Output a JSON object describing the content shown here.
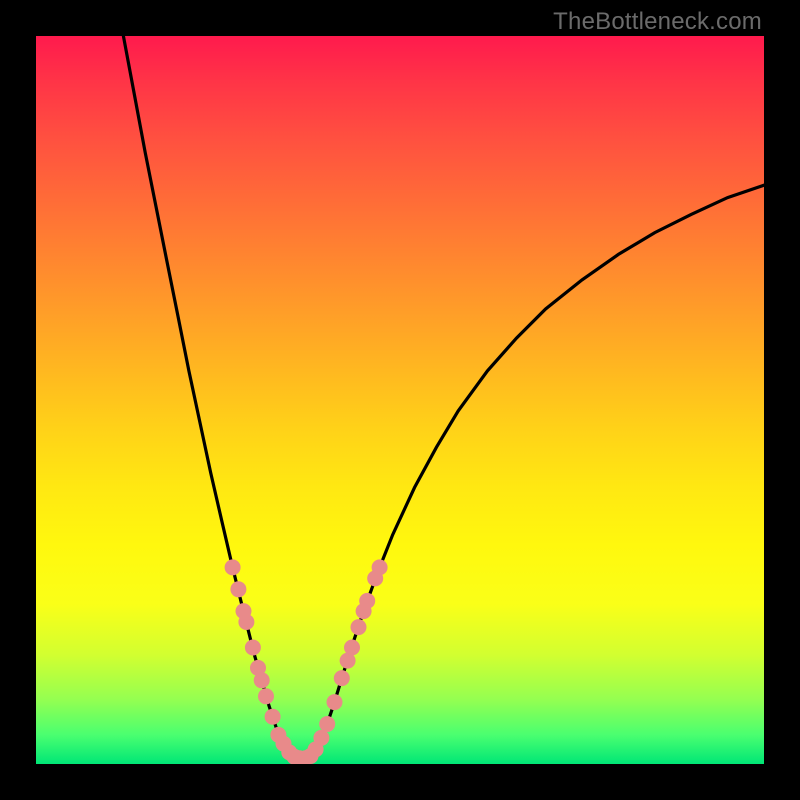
{
  "watermark": "TheBottleneck.com",
  "colors": {
    "gradient_top": "#ff1a4d",
    "gradient_bottom": "#00e676",
    "curve_stroke": "#000000",
    "marker_fill": "#e88a8a",
    "marker_stroke": "#b85a5a",
    "frame": "#000000"
  },
  "chart_data": {
    "type": "line",
    "title": "",
    "xlabel": "",
    "ylabel": "",
    "xlim": [
      0,
      100
    ],
    "ylim": [
      0,
      100
    ],
    "curve_points": [
      {
        "x": 12.0,
        "y": 100.0
      },
      {
        "x": 13.5,
        "y": 92.0
      },
      {
        "x": 15.0,
        "y": 84.0
      },
      {
        "x": 16.5,
        "y": 76.5
      },
      {
        "x": 18.0,
        "y": 69.0
      },
      {
        "x": 19.5,
        "y": 61.5
      },
      {
        "x": 21.0,
        "y": 54.0
      },
      {
        "x": 22.5,
        "y": 47.0
      },
      {
        "x": 24.0,
        "y": 40.0
      },
      {
        "x": 25.5,
        "y": 33.5
      },
      {
        "x": 27.0,
        "y": 27.0
      },
      {
        "x": 28.0,
        "y": 23.0
      },
      {
        "x": 29.0,
        "y": 19.0
      },
      {
        "x": 30.0,
        "y": 15.0
      },
      {
        "x": 31.0,
        "y": 11.5
      },
      {
        "x": 32.0,
        "y": 8.0
      },
      {
        "x": 33.0,
        "y": 5.0
      },
      {
        "x": 34.0,
        "y": 2.8
      },
      {
        "x": 35.0,
        "y": 1.4
      },
      {
        "x": 36.0,
        "y": 0.8
      },
      {
        "x": 37.0,
        "y": 0.8
      },
      {
        "x": 38.0,
        "y": 1.4
      },
      {
        "x": 39.0,
        "y": 3.0
      },
      {
        "x": 40.0,
        "y": 5.5
      },
      {
        "x": 41.0,
        "y": 8.5
      },
      {
        "x": 42.0,
        "y": 11.8
      },
      {
        "x": 43.5,
        "y": 16.5
      },
      {
        "x": 45.0,
        "y": 21.0
      },
      {
        "x": 47.0,
        "y": 26.5
      },
      {
        "x": 49.0,
        "y": 31.5
      },
      {
        "x": 52.0,
        "y": 38.0
      },
      {
        "x": 55.0,
        "y": 43.5
      },
      {
        "x": 58.0,
        "y": 48.5
      },
      {
        "x": 62.0,
        "y": 54.0
      },
      {
        "x": 66.0,
        "y": 58.5
      },
      {
        "x": 70.0,
        "y": 62.5
      },
      {
        "x": 75.0,
        "y": 66.5
      },
      {
        "x": 80.0,
        "y": 70.0
      },
      {
        "x": 85.0,
        "y": 73.0
      },
      {
        "x": 90.0,
        "y": 75.5
      },
      {
        "x": 95.0,
        "y": 77.8
      },
      {
        "x": 100.0,
        "y": 79.5
      }
    ],
    "marker_points": [
      {
        "x": 27.0,
        "y": 27.0
      },
      {
        "x": 27.8,
        "y": 24.0
      },
      {
        "x": 28.5,
        "y": 21.0
      },
      {
        "x": 28.9,
        "y": 19.5
      },
      {
        "x": 29.8,
        "y": 16.0
      },
      {
        "x": 30.5,
        "y": 13.2
      },
      {
        "x": 31.0,
        "y": 11.5
      },
      {
        "x": 31.6,
        "y": 9.3
      },
      {
        "x": 32.5,
        "y": 6.5
      },
      {
        "x": 33.3,
        "y": 4.0
      },
      {
        "x": 34.0,
        "y": 2.8
      },
      {
        "x": 34.8,
        "y": 1.6
      },
      {
        "x": 35.5,
        "y": 1.0
      },
      {
        "x": 36.2,
        "y": 0.8
      },
      {
        "x": 37.0,
        "y": 0.8
      },
      {
        "x": 37.7,
        "y": 1.1
      },
      {
        "x": 38.4,
        "y": 2.0
      },
      {
        "x": 39.2,
        "y": 3.6
      },
      {
        "x": 40.0,
        "y": 5.5
      },
      {
        "x": 41.0,
        "y": 8.5
      },
      {
        "x": 42.0,
        "y": 11.8
      },
      {
        "x": 42.8,
        "y": 14.2
      },
      {
        "x": 43.4,
        "y": 16.0
      },
      {
        "x": 44.3,
        "y": 18.8
      },
      {
        "x": 45.0,
        "y": 21.0
      },
      {
        "x": 45.5,
        "y": 22.4
      },
      {
        "x": 46.6,
        "y": 25.5
      },
      {
        "x": 47.2,
        "y": 27.0
      }
    ],
    "marker_radius_px": 8
  }
}
